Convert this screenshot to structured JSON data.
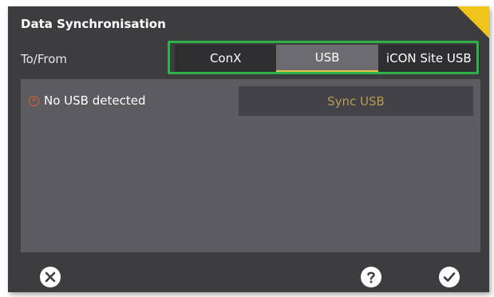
{
  "dialog": {
    "title": "Data Synchronisation",
    "to_from_label": "To/From",
    "tabs": [
      {
        "label": "ConX",
        "selected": false
      },
      {
        "label": "USB",
        "selected": true
      },
      {
        "label": "iCON Site USB",
        "selected": false
      }
    ],
    "status_text": "No USB detected",
    "status_icon": "error-circle-icon",
    "sync_button_label": "Sync USB",
    "footer_icons": [
      "close-icon",
      "help-icon",
      "confirm-icon"
    ]
  },
  "colors": {
    "accent_yellow": "#f0c419",
    "highlight_green": "#2db34a",
    "error": "#d9603b",
    "disabled_text": "#b89a55"
  }
}
